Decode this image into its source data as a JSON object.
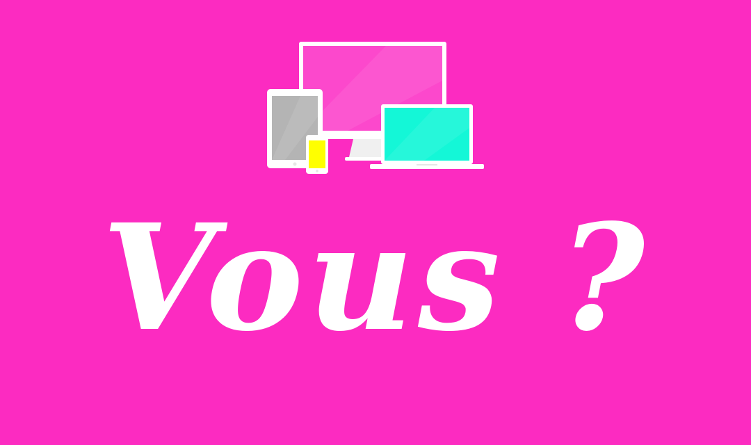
{
  "background_color": "#fc2bc1",
  "headline": {
    "text": "Vous ?",
    "color": "#ffffff"
  },
  "devices_illustration": {
    "icons": [
      "desktop-monitor-icon",
      "tablet-icon",
      "smartphone-icon",
      "laptop-icon"
    ],
    "colors": {
      "frame": "#ffffff",
      "monitor_screen": "#fc48cc",
      "tablet_screen": "#b4b4b4",
      "phone_screen": "#ffff00",
      "laptop_screen": "#14f7d7"
    }
  }
}
